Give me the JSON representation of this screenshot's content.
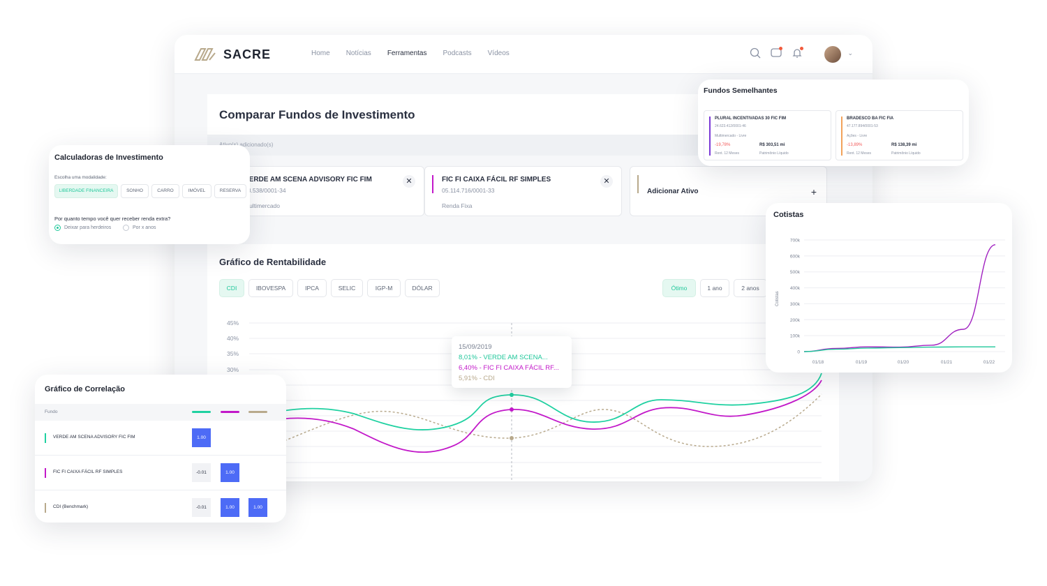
{
  "app": {
    "brand": "SACRE"
  },
  "nav": [
    "Home",
    "Notícias",
    "Ferramentas",
    "Podcasts",
    "Vídeos"
  ],
  "nav_active": "Ferramentas",
  "compare": {
    "title": "Comparar Fundos de Investimento",
    "added_label": "Ativo(s) adicionado(s)",
    "assets": [
      {
        "name": "VERDE AM SCENA ADVISORY FIC FIM",
        "cnpj": "28.538/0001-34",
        "class": "Multimercado",
        "color": "#1fd1a1"
      },
      {
        "name": "FIC FI CAIXA FÁCIL RF SIMPLES",
        "cnpj": "05.114.716/0001-33",
        "class": "Renda Fixa",
        "color": "#c218c9"
      }
    ],
    "add_label": "Adicionar Ativo",
    "add_color": "#b8a98c"
  },
  "rentabilidade": {
    "title": "Gráfico de Rentabilidade",
    "benchmarks": [
      "CDI",
      "IBOVESPA",
      "IPCA",
      "SELIC",
      "IGP-M",
      "DÓLAR"
    ],
    "benchmark_active": "CDI",
    "periods": [
      "Ótimo",
      "1 ano",
      "2 anos"
    ],
    "period_active": "Ótimo",
    "y_ticks": [
      "45%",
      "40%",
      "35%",
      "30%"
    ],
    "tooltip": {
      "date": "15/09/2019",
      "lines": [
        {
          "text": "8,01% - VERDE AM SCENA...",
          "color": "#1fc79a"
        },
        {
          "text": "6,40% - FIC FI CAIXA FÁCIL RF...",
          "color": "#c218c9"
        },
        {
          "text": "5,91% - CDI",
          "color": "#b8a98c"
        }
      ]
    }
  },
  "calculadoras": {
    "title": "Calculadoras de Investimento",
    "subtitle": "Escolha uma modalidade:",
    "modes": [
      "LIBERDADE FINANCEIRA",
      "SONHO",
      "CARRO",
      "IMÓVEL",
      "RESERVA"
    ],
    "mode_active": "LIBERDADE FINANCEIRA",
    "question": "Por quanto tempo você quer receber renda extra?",
    "options": [
      "Deixar para herdeiros",
      "Por x anos"
    ],
    "option_selected": "Deixar para herdeiros"
  },
  "semelhantes": {
    "title": "Fundos Semelhantes",
    "funds": [
      {
        "name": "PLURAL INCENTIVADAS 30 FIC FIM",
        "cnpj": "24.623.412/0001-46",
        "type": "Multimercado - Livre",
        "rent": "-19,78%",
        "rent_label": "Rent. 12 Meses",
        "pl": "R$ 303,51 mi",
        "pl_label": "Patrimônio Líquido",
        "color": "#7a3ad6"
      },
      {
        "name": "BRADESCO BA FIC FIA",
        "cnpj": "47.177.894/0001-53",
        "type": "Ações - Livre",
        "rent": "-13,89%",
        "rent_label": "Rent. 12 Meses",
        "pl": "R$ 138,39 mi",
        "pl_label": "Patrimônio Líquido",
        "color": "#f2a25a"
      }
    ]
  },
  "cotistas": {
    "title": "Cotistas",
    "chart_data": {
      "type": "line",
      "ylabel": "Cotistas",
      "y_ticks": [
        "700k",
        "600k",
        "500k",
        "400k",
        "300k",
        "200k",
        "100k",
        "0"
      ],
      "ylim": [
        0,
        700000
      ],
      "x_ticks": [
        "01/18",
        "01/19",
        "01/20",
        "01/21",
        "01/22"
      ],
      "series": [
        {
          "color": "#a020c0",
          "values": [
            0,
            20000,
            30000,
            28000,
            40000,
            140000,
            670000
          ]
        },
        {
          "color": "#1fc79a",
          "values": [
            0,
            15000,
            22000,
            25000,
            28000,
            30000,
            30000
          ]
        }
      ]
    }
  },
  "correlacao": {
    "title": "Gráfico de Correlação",
    "column_label": "Fundo",
    "swatches": [
      "#1fd1a1",
      "#c218c9",
      "#b8a98c"
    ],
    "rows": [
      {
        "name": "VERDE AM SCENA ADVISORY FIC FIM",
        "color": "#1fd1a1",
        "cells": [
          "1.00"
        ]
      },
      {
        "name": "FIC FI CAIXA FÁCIL RF SIMPLES",
        "color": "#c218c9",
        "cells": [
          "-0.01",
          "1.00"
        ]
      },
      {
        "name": "CDI (Benchmark)",
        "color": "#b8a98c",
        "cells": [
          "-0.01",
          "1.00",
          "1.00"
        ]
      }
    ]
  }
}
